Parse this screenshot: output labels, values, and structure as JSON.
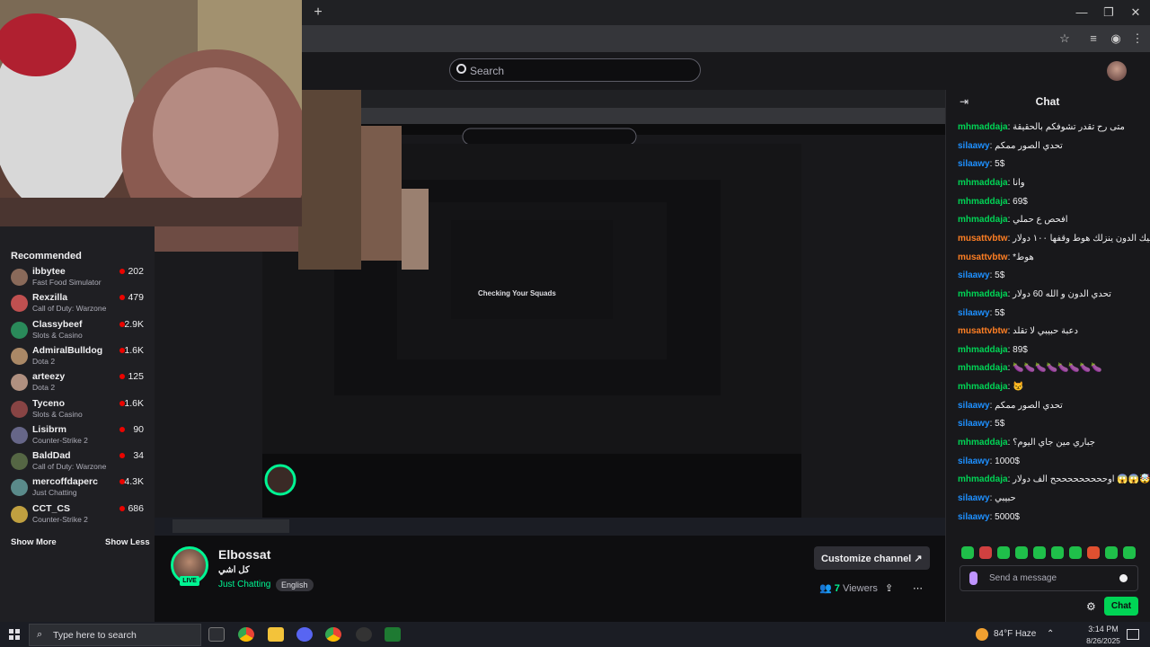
{
  "browser": {
    "new_tab": "+"
  },
  "topnav": {
    "search_placeholder": "Search"
  },
  "sidebar": {
    "title": "Recommended",
    "channels": [
      {
        "name": "ibbytee",
        "game": "Fast Food Simulator",
        "viewers": "202"
      },
      {
        "name": "Rexzilla",
        "game": "Call of Duty: Warzone",
        "viewers": "479"
      },
      {
        "name": "Classybeef",
        "game": "Slots & Casino",
        "viewers": "2.9K"
      },
      {
        "name": "AdmiralBulldog",
        "game": "Dota 2",
        "viewers": "1.6K"
      },
      {
        "name": "arteezy",
        "game": "Dota 2",
        "viewers": "125"
      },
      {
        "name": "Tyceno",
        "game": "Slots & Casino",
        "viewers": "1.6K"
      },
      {
        "name": "Lisibrm",
        "game": "Counter-Strike 2",
        "viewers": "90"
      },
      {
        "name": "BaldDad",
        "game": "Call of Duty: Warzone",
        "viewers": "34"
      },
      {
        "name": "mercoffdaperc",
        "game": "Just Chatting",
        "viewers": "4.3K"
      },
      {
        "name": "CCT_CS",
        "game": "Counter-Strike 2",
        "viewers": "686"
      }
    ],
    "show_more": "Show More",
    "show_less": "Show Less"
  },
  "player": {
    "overlay_text": "Checking Your Squads"
  },
  "stream": {
    "live": "LIVE",
    "streamer": "Elbossat",
    "title": "كل اشي",
    "category": "Just Chatting",
    "tag": "English",
    "customize": "Customize channel",
    "viewers": "7",
    "viewers_label": "Viewers"
  },
  "chat": {
    "title": "Chat",
    "messages": [
      {
        "user": "mhmaddaja",
        "text": "متى رح تقدر تشوفكم بالحقيقة",
        "color": "#00d455"
      },
      {
        "user": "silaawy",
        "text": "تحدي الصور ممكم",
        "color": "#1e90ff"
      },
      {
        "user": "silaawy",
        "text": "5$",
        "color": "#1e90ff"
      },
      {
        "user": "mhmaddaja",
        "text": "وانا",
        "color": "#00d455"
      },
      {
        "user": "mhmaddaja",
        "text": "69$",
        "color": "#00d455"
      },
      {
        "user": "mhmaddaja",
        "text": "افحص ع حملي",
        "color": "#00d455"
      },
      {
        "user": "musattvbtw",
        "text": "إذا يحيك الدون ينزلك هوط وقفها ١٠٠ دولار",
        "color": "#ff7f24"
      },
      {
        "user": "musattvbtw",
        "text": "*هوط",
        "color": "#ff7f24"
      },
      {
        "user": "silaawy",
        "text": "5$",
        "color": "#1e90ff"
      },
      {
        "user": "mhmaddaja",
        "text": "تحدي الدون و الله 60 دولار",
        "color": "#00d455"
      },
      {
        "user": "silaawy",
        "text": "5$",
        "color": "#1e90ff"
      },
      {
        "user": "musattvbtw",
        "text": "دعبة حبيبي لا تقلد",
        "color": "#ff7f24"
      },
      {
        "user": "mhmaddaja",
        "text": "89$",
        "color": "#00d455"
      },
      {
        "user": "mhmaddaja",
        "text": "🍆🍆🍆🍆🍆🍆🍆🍆",
        "color": "#00d455"
      },
      {
        "user": "mhmaddaja",
        "text": "😾",
        "color": "#00d455"
      },
      {
        "user": "silaawy",
        "text": "تحدي الصور ممكم",
        "color": "#1e90ff"
      },
      {
        "user": "silaawy",
        "text": "5$",
        "color": "#1e90ff"
      },
      {
        "user": "mhmaddaja",
        "text": "جباري مين جاي اليوم؟",
        "color": "#00d455"
      },
      {
        "user": "silaawy",
        "text": "1000$",
        "color": "#1e90ff"
      },
      {
        "user": "mhmaddaja",
        "text": "اوحححححححححح الف دولار 😱😱🤯",
        "color": "#00d455"
      },
      {
        "user": "silaawy",
        "text": "حبيبي",
        "color": "#1e90ff"
      },
      {
        "user": "silaawy",
        "text": "5000$",
        "color": "#1e90ff"
      }
    ],
    "input_placeholder": "Send a message",
    "send": "Chat"
  },
  "taskbar": {
    "search_placeholder": "Type here to search",
    "weather": "84°F  Haze",
    "time": "3:14 PM",
    "date": "8/26/2025"
  }
}
